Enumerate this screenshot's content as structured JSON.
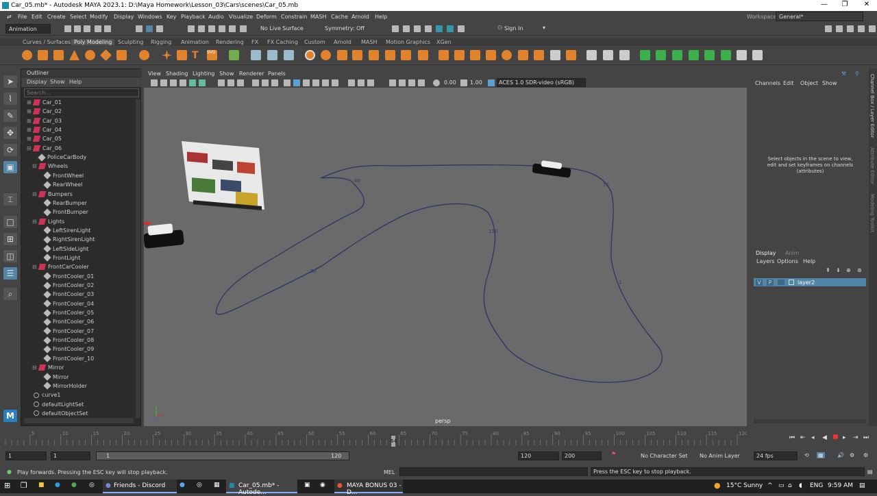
{
  "window": {
    "title": "Car_05.mb* - Autodesk MAYA 2023.1: D:\\Maya Homework\\Lesson_03\\Cars\\scenes\\Car_05.mb",
    "min": "—",
    "max": "❐",
    "close": "✕"
  },
  "menu": [
    "File",
    "Edit",
    "Create",
    "Select",
    "Modify",
    "Display",
    "Windows",
    "Key",
    "Playback",
    "Audio",
    "Visualize",
    "Deform",
    "Constrain",
    "MASH",
    "Cache",
    "Arnold",
    "Help"
  ],
  "workspace": {
    "label": "Workspace:",
    "value": "General*"
  },
  "status": {
    "mode": "Animation",
    "live": "No Live Surface",
    "symmetry": "Symmetry: Off",
    "signin": "Sign In"
  },
  "shelf_tabs": [
    "Curves / Surfaces",
    "Poly Modeling",
    "Sculpting",
    "Rigging",
    "Animation",
    "Rendering",
    "FX",
    "FX Caching",
    "Custom",
    "Arnold",
    "MASH",
    "Motion Graphics",
    "XGen"
  ],
  "shelf_active": "Poly Modeling",
  "outliner": {
    "title": "Outliner",
    "menus": [
      "Display",
      "Show",
      "Help"
    ],
    "search": "Search...",
    "items": [
      {
        "label": "Car_01",
        "d": 0,
        "t": "car",
        "ex": "⊞"
      },
      {
        "label": "Car_02",
        "d": 0,
        "t": "car",
        "ex": "⊞"
      },
      {
        "label": "Car_03",
        "d": 0,
        "t": "car",
        "ex": "⊞"
      },
      {
        "label": "Car_04",
        "d": 0,
        "t": "car",
        "ex": "⊞"
      },
      {
        "label": "Car_05",
        "d": 0,
        "t": "car",
        "ex": "⊞"
      },
      {
        "label": "Car_06",
        "d": 0,
        "t": "car",
        "ex": "⊟"
      },
      {
        "label": "PoliceCarBody",
        "d": 1,
        "t": "mesh",
        "ex": ""
      },
      {
        "label": "Wheels",
        "d": 1,
        "t": "car",
        "ex": "⊟"
      },
      {
        "label": "FrontWheel",
        "d": 2,
        "t": "mesh",
        "ex": ""
      },
      {
        "label": "RearWheel",
        "d": 2,
        "t": "mesh",
        "ex": ""
      },
      {
        "label": "Bumpers",
        "d": 1,
        "t": "car",
        "ex": "⊟"
      },
      {
        "label": "RearBumper",
        "d": 2,
        "t": "mesh",
        "ex": ""
      },
      {
        "label": "FrontBumper",
        "d": 2,
        "t": "mesh",
        "ex": ""
      },
      {
        "label": "Lights",
        "d": 1,
        "t": "car",
        "ex": "⊟"
      },
      {
        "label": "LeftSirenLight",
        "d": 2,
        "t": "mesh",
        "ex": ""
      },
      {
        "label": "RightSirenLight",
        "d": 2,
        "t": "mesh",
        "ex": ""
      },
      {
        "label": "LeftSideLight",
        "d": 2,
        "t": "mesh",
        "ex": ""
      },
      {
        "label": "FrontLight",
        "d": 2,
        "t": "mesh",
        "ex": ""
      },
      {
        "label": "FrontCarCooler",
        "d": 1,
        "t": "car",
        "ex": "⊟"
      },
      {
        "label": "FrontCooler_01",
        "d": 2,
        "t": "mesh",
        "ex": ""
      },
      {
        "label": "FrontCooler_02",
        "d": 2,
        "t": "mesh",
        "ex": ""
      },
      {
        "label": "FrontCooler_03",
        "d": 2,
        "t": "mesh",
        "ex": ""
      },
      {
        "label": "FrontCooler_04",
        "d": 2,
        "t": "mesh",
        "ex": ""
      },
      {
        "label": "FrontCooler_05",
        "d": 2,
        "t": "mesh",
        "ex": ""
      },
      {
        "label": "FrontCooler_06",
        "d": 2,
        "t": "mesh",
        "ex": ""
      },
      {
        "label": "FrontCooler_07",
        "d": 2,
        "t": "mesh",
        "ex": ""
      },
      {
        "label": "FrontCooler_08",
        "d": 2,
        "t": "mesh",
        "ex": ""
      },
      {
        "label": "FrontCooler_09",
        "d": 2,
        "t": "mesh",
        "ex": ""
      },
      {
        "label": "FrontCooler_10",
        "d": 2,
        "t": "mesh",
        "ex": ""
      },
      {
        "label": "Mirror",
        "d": 1,
        "t": "car",
        "ex": "⊟"
      },
      {
        "label": "Mirror",
        "d": 2,
        "t": "mesh",
        "ex": ""
      },
      {
        "label": "MirrorHolder",
        "d": 2,
        "t": "mesh",
        "ex": ""
      },
      {
        "label": "curve1",
        "d": 0,
        "t": "curve",
        "ex": ""
      },
      {
        "label": "defaultLightSet",
        "d": 0,
        "t": "set",
        "ex": ""
      },
      {
        "label": "defaultObjectSet",
        "d": 0,
        "t": "set",
        "ex": ""
      }
    ]
  },
  "viewport": {
    "menus": [
      "View",
      "Shading",
      "Lighting",
      "Show",
      "Renderer",
      "Panels"
    ],
    "exposure": "0.00",
    "gamma": "1.00",
    "colorspace": "ACES 1.0 SDR-video (sRGB)",
    "camera": "persp",
    "keylabels": [
      "40",
      "70",
      "110",
      "80",
      "1"
    ]
  },
  "channelbox": {
    "menus": [
      "Channels",
      "Edit",
      "Object",
      "Show"
    ],
    "hint": "Select objects in the scene to view, edit and set keyframes on channels (attributes)"
  },
  "layers": {
    "tabs": [
      "Display",
      "Anim"
    ],
    "menus": [
      "Layers",
      "Options",
      "Help"
    ],
    "row": {
      "v": "V",
      "p": "P",
      "name": "layer2"
    }
  },
  "rightstrip": [
    "Channel Box / Layer Editor",
    "Attribute Editor",
    "Modeling Toolkit"
  ],
  "timeline": {
    "ticks": [
      "5",
      "10",
      "15",
      "20",
      "25",
      "30",
      "35",
      "40",
      "45",
      "50",
      "55",
      "60",
      "65",
      "70",
      "75",
      "80",
      "85",
      "90",
      "95",
      "100",
      "105",
      "110",
      "115",
      "120"
    ],
    "current": "64",
    "current_fraction": 0.53
  },
  "range": {
    "start": "1",
    "inner_start": "1",
    "slider_start": "1",
    "slider_end": "120",
    "inner_end": "120",
    "end": "200",
    "charset": "No Character Set",
    "animlayer": "No Anim Layer",
    "fps": "24 fps"
  },
  "cmd": {
    "help": "Play forwards. Pressing the ESC key will stop playback.",
    "lang": "MEL",
    "status": "Press the ESC key to stop playback."
  },
  "taskbar": {
    "apps": [
      "Friends - Discord",
      "Car_05.mb* - Autode...",
      "MAYA BONUS 03 - D..."
    ],
    "weather": "15°C  Sunny",
    "lang": "ENG",
    "time": "9:59 AM"
  }
}
